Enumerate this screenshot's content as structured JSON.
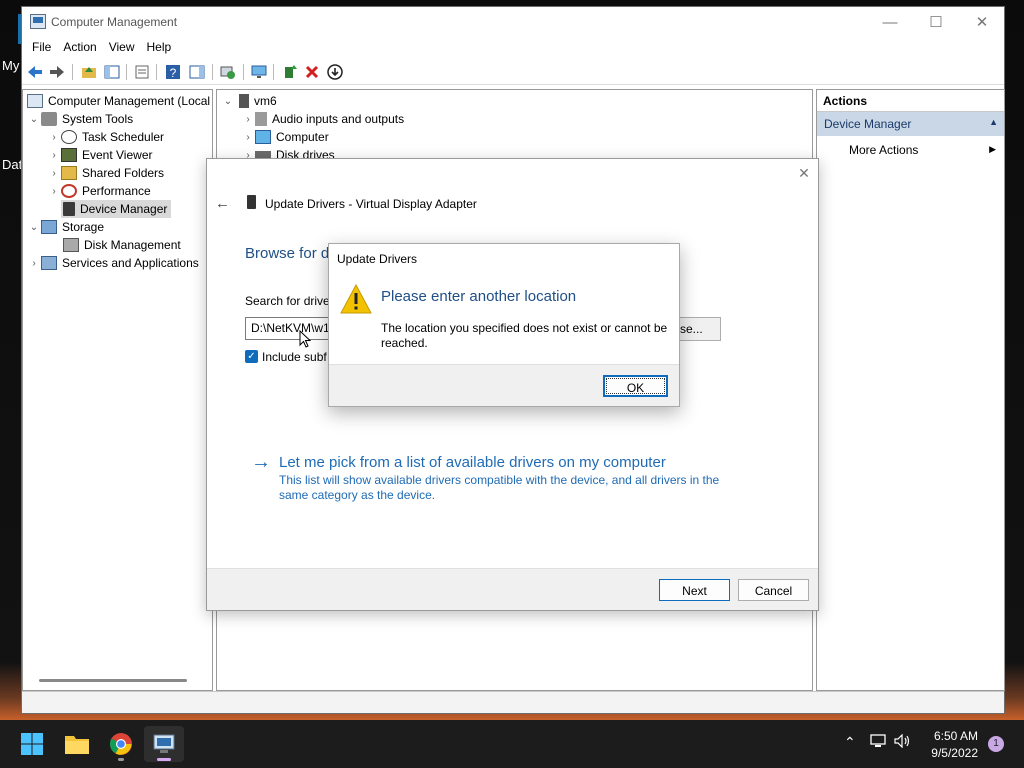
{
  "desktop": {
    "label_1": "My",
    "label_2": "Dat"
  },
  "window": {
    "title": "Computer Management",
    "menu": [
      "File",
      "Action",
      "View",
      "Help"
    ]
  },
  "tree": {
    "root": "Computer Management (Local",
    "system_tools": "System Tools",
    "task_scheduler": "Task Scheduler",
    "event_viewer": "Event Viewer",
    "shared_folders": "Shared Folders",
    "performance": "Performance",
    "device_manager": "Device Manager",
    "storage": "Storage",
    "disk_management": "Disk Management",
    "services": "Services and Applications"
  },
  "devices": {
    "root": "vm6",
    "audio": "Audio inputs and outputs",
    "computer": "Computer",
    "disk_drives": "Disk drives"
  },
  "actions": {
    "header": "Actions",
    "section": "Device Manager",
    "more": "More Actions"
  },
  "update_dialog": {
    "title": "Update Drivers - Virtual Display Adapter",
    "heading": "Browse for d",
    "search_label": "Search for driver",
    "path_value": "D:\\NetKVM\\w1",
    "browse_label": "se...",
    "include_label": "Include subf",
    "pick_link": "Let me pick from a list of available drivers on my computer",
    "pick_desc": "This list will show available drivers compatible with the device, and all drivers in the same category as the device.",
    "next_label": "Next",
    "cancel_label": "Cancel"
  },
  "message_box": {
    "title": "Update Drivers",
    "heading": "Please enter another location",
    "text": "The location you specified does not exist or cannot be reached.",
    "ok_label": "OK"
  },
  "taskbar": {
    "time": "6:50 AM",
    "date": "9/5/2022",
    "notification_count": "1"
  },
  "colors": {
    "accent": "#0f6cbd",
    "link": "#1f6bb5",
    "heading": "#1f4f86",
    "selection": "#c9d7e6"
  }
}
